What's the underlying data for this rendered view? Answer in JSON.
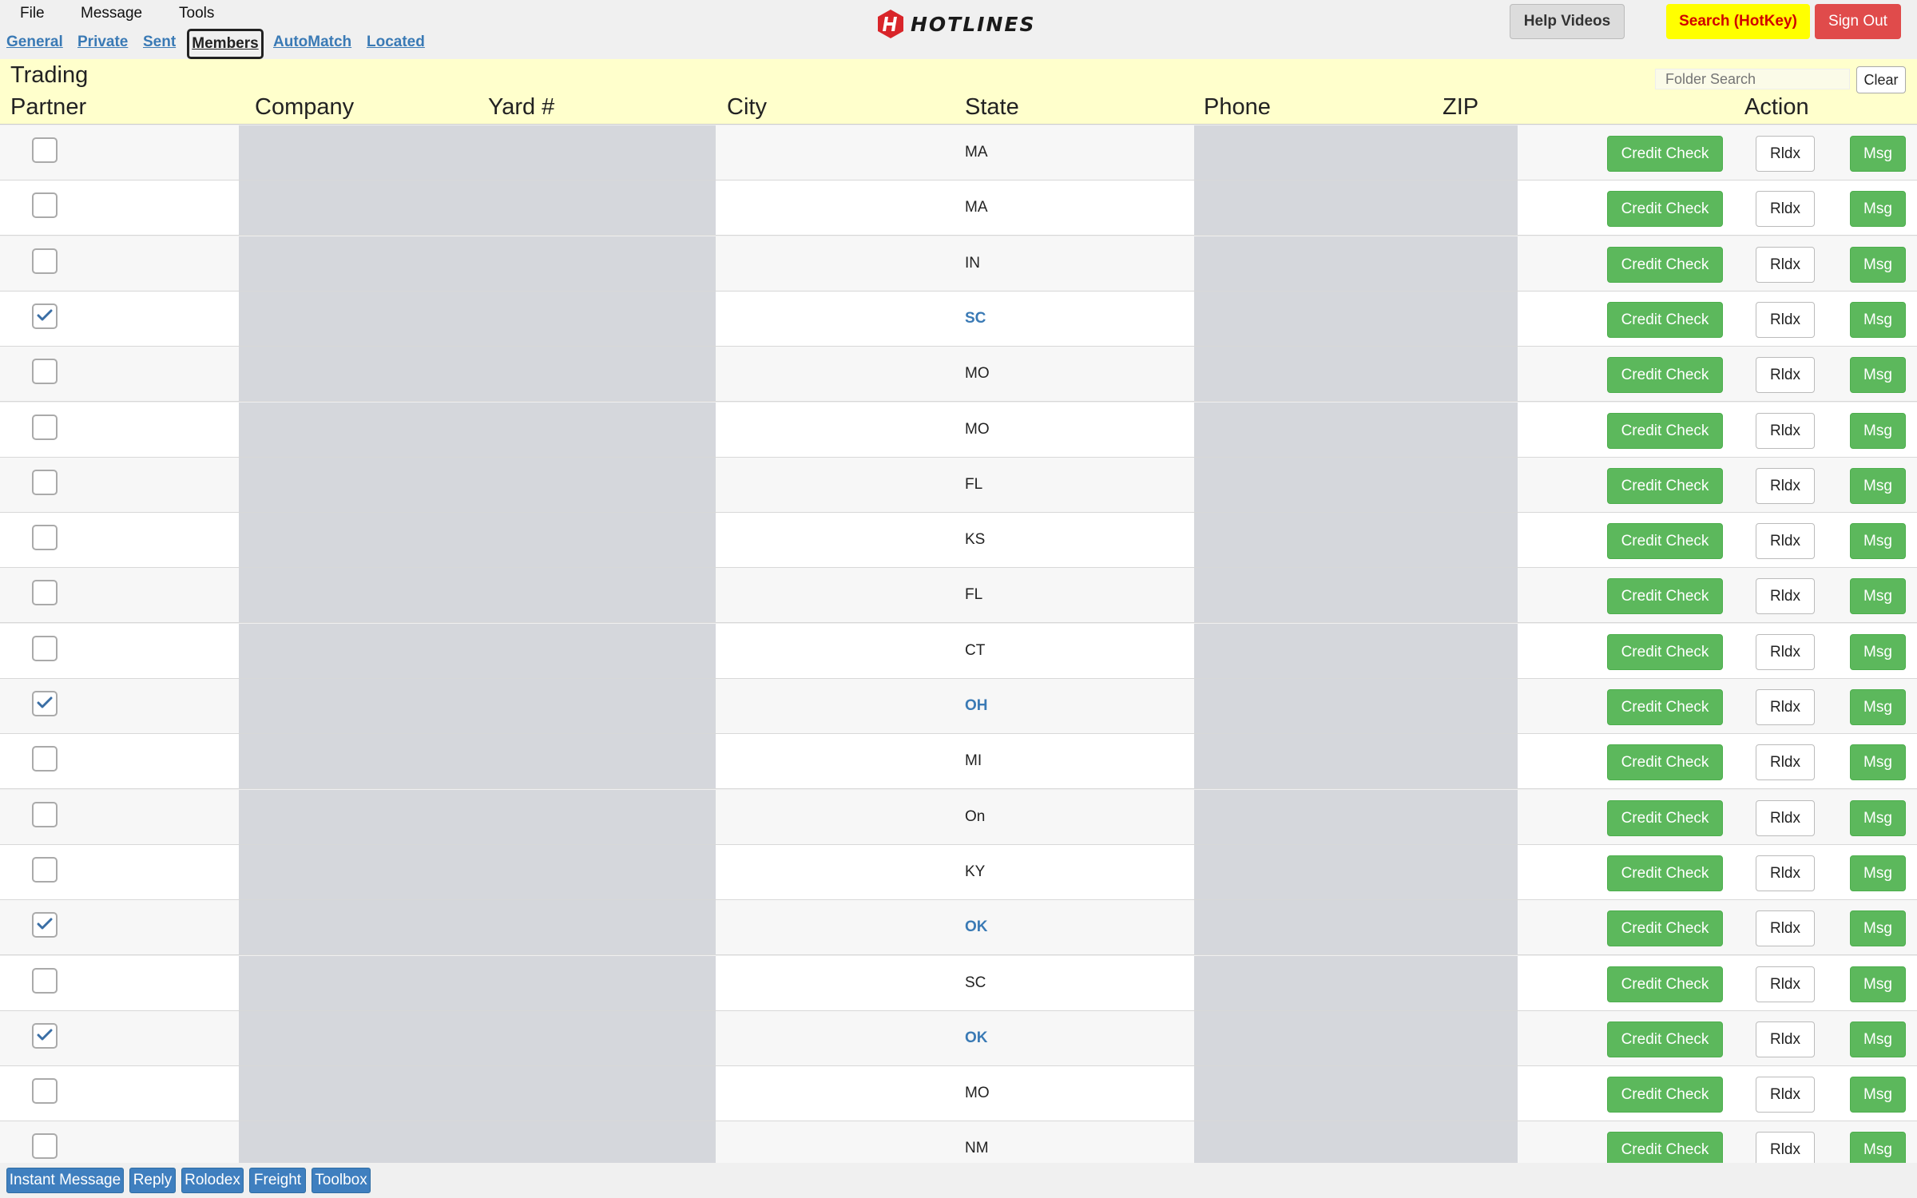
{
  "menu": [
    "File",
    "Message",
    "Tools"
  ],
  "logo_text": "HOTLINES",
  "top_buttons": {
    "help": "Help Videos",
    "search": "Search (HotKey)",
    "signout": "Sign Out"
  },
  "tabs": [
    {
      "label": "General",
      "active": false
    },
    {
      "label": "Private",
      "active": false
    },
    {
      "label": "Sent",
      "active": false
    },
    {
      "label": "Members",
      "active": true
    },
    {
      "label": "AutoMatch",
      "active": false
    },
    {
      "label": "Located",
      "active": false
    }
  ],
  "header": {
    "col_trading": "Trading",
    "col_partner": "Partner",
    "col_company": "Company",
    "col_yard": "Yard #",
    "col_city": "City",
    "col_state": "State",
    "col_phone": "Phone",
    "col_zip": "ZIP",
    "col_action": "Action",
    "folder_search_placeholder": "Folder Search",
    "clear_label": "Clear"
  },
  "row_actions": {
    "credit": "Credit Check",
    "rldx": "Rldx",
    "msg": "Msg"
  },
  "rows": [
    {
      "checked": false,
      "state": "MA"
    },
    {
      "checked": false,
      "state": "MA"
    },
    {
      "checked": false,
      "state": "IN"
    },
    {
      "checked": true,
      "state": "SC"
    },
    {
      "checked": false,
      "state": "MO"
    },
    {
      "checked": false,
      "state": "MO"
    },
    {
      "checked": false,
      "state": "FL"
    },
    {
      "checked": false,
      "state": "KS"
    },
    {
      "checked": false,
      "state": "FL"
    },
    {
      "checked": false,
      "state": "CT"
    },
    {
      "checked": true,
      "state": "OH"
    },
    {
      "checked": false,
      "state": "MI"
    },
    {
      "checked": false,
      "state": "On"
    },
    {
      "checked": false,
      "state": "KY"
    },
    {
      "checked": true,
      "state": "OK"
    },
    {
      "checked": false,
      "state": "SC"
    },
    {
      "checked": true,
      "state": "OK"
    },
    {
      "checked": false,
      "state": "MO"
    },
    {
      "checked": false,
      "state": "NM"
    }
  ],
  "bottom_buttons": [
    "Instant Message",
    "Reply",
    "Rolodex",
    "Freight",
    "Toolbox"
  ],
  "colors": {
    "accent_green": "#5cb85c",
    "link_blue": "#3a7ab5",
    "header_yellow": "#ffffcc",
    "signout_red": "#e04b4b",
    "search_yellow": "#ffff00"
  }
}
